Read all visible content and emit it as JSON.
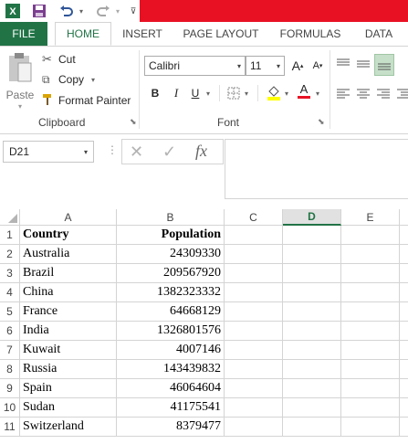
{
  "accent_color": "#217346",
  "title_bar_color": "#e81123",
  "quick_access": {
    "app_icon": "excel-icon",
    "save_icon": "save-icon",
    "undo_icon": "undo-icon",
    "redo_icon": "redo-icon",
    "customize_icon": "customize-qat-icon"
  },
  "tabs": [
    "FILE",
    "HOME",
    "INSERT",
    "PAGE LAYOUT",
    "FORMULAS",
    "DATA"
  ],
  "ribbon": {
    "clipboard": {
      "paste_label": "Paste",
      "cut_label": "Cut",
      "copy_label": "Copy",
      "format_painter_label": "Format Painter",
      "group_label": "Clipboard"
    },
    "font": {
      "font_name": "Calibri",
      "font_size": "11",
      "bold_label": "B",
      "italic_label": "I",
      "underline_label": "U",
      "font_color_label": "A",
      "grow_label": "A",
      "shrink_label": "A",
      "group_label": "Font",
      "fill_color": "#ffff00",
      "font_color": "#e81123"
    }
  },
  "formula_bar": {
    "name_box": "D21",
    "fx_label": "fx",
    "formula": ""
  },
  "columns": [
    "A",
    "B",
    "C",
    "D",
    "E"
  ],
  "active_column": "D",
  "rows": [
    "1",
    "2",
    "3",
    "4",
    "5",
    "6",
    "7",
    "8",
    "9",
    "10",
    "11"
  ],
  "header": {
    "country": "Country",
    "population": "Population"
  },
  "data": [
    {
      "country": "Australia",
      "population": "24309330"
    },
    {
      "country": "Brazil",
      "population": "209567920"
    },
    {
      "country": "China",
      "population": "1382323332"
    },
    {
      "country": "France",
      "population": "64668129"
    },
    {
      "country": "India",
      "population": "1326801576"
    },
    {
      "country": "Kuwait",
      "population": "4007146"
    },
    {
      "country": "Russia",
      "population": "143439832"
    },
    {
      "country": "Spain",
      "population": "46064604"
    },
    {
      "country": "Sudan",
      "population": "41175541"
    },
    {
      "country": "Switzerland",
      "population": "8379477"
    }
  ]
}
